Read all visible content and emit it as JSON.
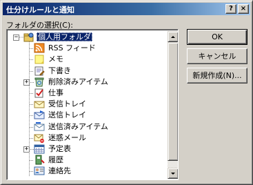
{
  "window": {
    "title": "仕分けルールと通知",
    "help_label": "?",
    "close_label": "×"
  },
  "folder_select_label": "フォルダの選択(C):",
  "tree": {
    "items": [
      {
        "label": "個人用フォルダ",
        "icon": "personal-folders-icon",
        "expander": "−",
        "selected": true
      },
      {
        "label": "RSS フィード",
        "icon": "rss-icon"
      },
      {
        "label": "メモ",
        "icon": "notes-icon"
      },
      {
        "label": "下書き",
        "icon": "drafts-icon"
      },
      {
        "label": "削除済みアイテム",
        "icon": "deleted-items-icon",
        "expander": "+"
      },
      {
        "label": "仕事",
        "icon": "tasks-icon"
      },
      {
        "label": "受信トレイ",
        "icon": "inbox-icon"
      },
      {
        "label": "送信トレイ",
        "icon": "outbox-icon"
      },
      {
        "label": "送信済みアイテム",
        "icon": "sent-items-icon"
      },
      {
        "label": "迷惑メール",
        "icon": "junk-mail-icon"
      },
      {
        "label": "予定表",
        "icon": "calendar-icon",
        "expander": "+"
      },
      {
        "label": "履歴",
        "icon": "journal-icon"
      },
      {
        "label": "連絡先",
        "icon": "contacts-icon"
      }
    ]
  },
  "buttons": {
    "ok": "OK",
    "cancel": "キャンセル",
    "new": "新規作成(N)..."
  }
}
